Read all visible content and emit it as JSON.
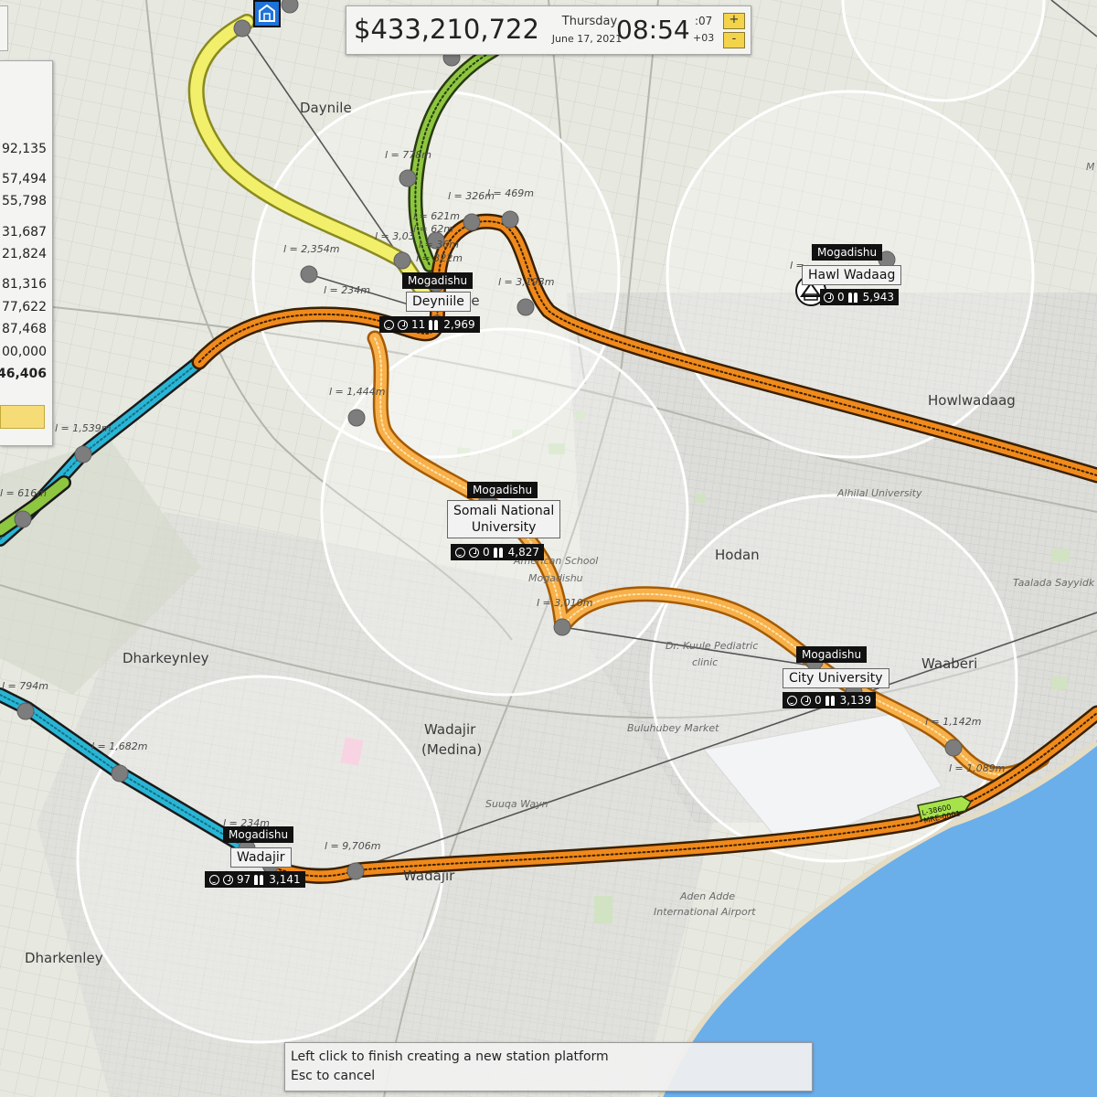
{
  "hud": {
    "money": "$433,210,722",
    "weekday": "Thursday",
    "date": "June 17, 2021",
    "clock": "08:54",
    "seconds": ":07",
    "offset": "+03",
    "speed_up_label": "+",
    "speed_down_label": "-"
  },
  "left_panel": {
    "values": [
      "92,135",
      "57,494",
      "55,798",
      "31,687",
      "21,824",
      "81,316",
      "77,622",
      "87,468",
      "00,000"
    ],
    "total": "46,406"
  },
  "places": {
    "daynile": "Daynile",
    "howlwadaag": "Howlwadaag",
    "hodan": "Hodan",
    "waaberi": "Waaberi",
    "dharkeynley": "Dharkeynley",
    "wadajir_medina_1": "Wadajir",
    "wadajir_medina_2": "(Medina)",
    "wadajir": "Wadajir",
    "dharkenley": "Dharkenley",
    "deyniile_partial": "ile"
  },
  "pois": {
    "alhilal": "Alhilal University",
    "american_school_1": "American School",
    "american_school_2": "Mogadishu",
    "pediatric_1": "Dr. Kuule Pediatric",
    "pediatric_2": "clinic",
    "market": "Buluhubey Market",
    "suuqa": "Suuqa Wayn",
    "airport_1": "Aden Adde",
    "airport_2": "International Airport",
    "taalada": "Taalada Sayyidk",
    "edge_m": "M"
  },
  "lengths": {
    "l778": "l = 778m",
    "l326": "l = 326m",
    "l469": "l = 469m",
    "l621": "l = 621m",
    "l62": "l = 62m",
    "l3035": "l = 3,03",
    "l336": "l = 36m",
    "l322": "l = 322m",
    "l2354": "l = 2,354m",
    "l234a": "l = 234m",
    "l3193": "l = 3,193m",
    "l1444": "l = 1,444m",
    "l1539": "l = 1,539m",
    "l616": "l = 616m",
    "l3010": "l = 3,010m",
    "l794": "l = 794m",
    "l1682": "l = 1,682m",
    "l234b": "l = 234m",
    "l9706": "l = 9,706m",
    "l1142": "l = 1,142m",
    "l1089": "l = 1,089m",
    "l_hw": "l ="
  },
  "stations": {
    "deyniile": {
      "city": "Mogadishu",
      "name": "Deyniile",
      "satisfaction": "",
      "wait": "11",
      "people": "2,969"
    },
    "howl_wadaag": {
      "city": "Mogadishu",
      "name": "Hawl Wadaag",
      "wait": "0",
      "people": "5,943"
    },
    "somali_nat": {
      "city": "Mogadishu",
      "name_line1": "Somali National",
      "name_line2": "University",
      "wait": "0",
      "people": "4,827"
    },
    "city_univ": {
      "city": "Mogadishu",
      "name": "City University",
      "wait": "0",
      "people": "3,139"
    },
    "wadajir": {
      "city": "Mogadishu",
      "name": "Wadajir",
      "wait": "97",
      "people": "3,141"
    }
  },
  "vehicle": {
    "line1": "L-38600",
    "line2": "MRE-0001"
  },
  "hint": {
    "line1": "Left click to finish creating a new station platform",
    "line2": "Esc to cancel"
  },
  "colors": {
    "orange_line": "#f08a1c",
    "light_orange_line": "#f7b04a",
    "yellow_line": "#f2f06a",
    "green_line": "#8dc63f",
    "cyan_line": "#29b6d6",
    "sea": "#6aaeea"
  }
}
